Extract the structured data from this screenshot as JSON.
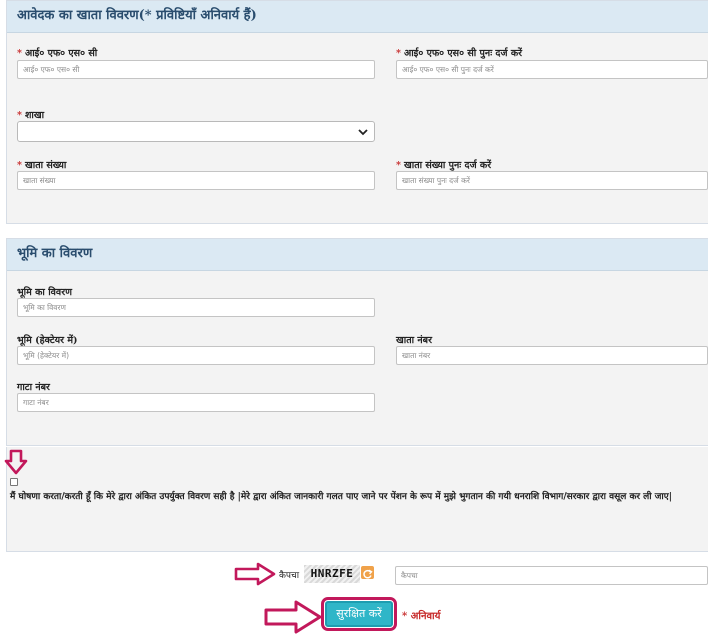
{
  "applicant_section": {
    "title": "आवेदक का खाता विवरण(* प्रविष्टियाँ अनिवार्य हैं)",
    "ifsc_label": "आई० एफ० एस० सी",
    "ifsc_placeholder": "आई० एफ० एस० सी",
    "ifsc_confirm_label": "आई० एफ० एस० सी पुनः दर्ज करें",
    "ifsc_confirm_placeholder": "आई० एफ० एस० सी पुनः दर्ज करें",
    "branch_label": "शाखा",
    "branch_value": "",
    "account_label": "खाता संख्या",
    "account_placeholder": "खाता संख्या",
    "account_confirm_label": "खाता संख्या पुनः दर्ज करें",
    "account_confirm_placeholder": "खाता संख्या पुनः दर्ज करें"
  },
  "land_section": {
    "title": "भूमि का विवरण",
    "land_detail_label": "भूमि का विवरण",
    "land_detail_placeholder": "भूमि का विवरण",
    "land_hectare_label": "भूमि (हेक्टेयर में)",
    "land_hectare_placeholder": "भूमि (हेक्टेयर में)",
    "khata_label": "खाता नंबर",
    "khata_placeholder": "खाता नंबर",
    "gata_label": "गाटा नंबर",
    "gata_placeholder": "गाटा नंबर"
  },
  "required_marker": "*",
  "declaration": {
    "checked": false,
    "text": "मैं घोषणा करता/करती हूँ कि मेरे द्वारा अंकित उपर्युक्त विवरण सही है |मेरे द्वारा अंकित जानकारी गलत पाए जाने पर पेंशन के रूप में मुझे भुगतान की गयी धनराशि विभाग/सरकार द्वारा वसूल कर ली जाए|"
  },
  "captcha": {
    "label": "कैपचा",
    "code": "HNRZFE",
    "placeholder": "कैपचा"
  },
  "submit": {
    "label": "सुरक्षित करें",
    "mandatory_note": "* अनिवार्य"
  },
  "colors": {
    "panel_header": "#dbe9f3",
    "panel_bg": "#f3f3f3",
    "required": "#c62828",
    "button": "#2fb6c8",
    "annotation_arrow": "#c2185b"
  },
  "icons": [
    "chevron-down-icon",
    "refresh-icon",
    "annotation-arrow-icon"
  ]
}
